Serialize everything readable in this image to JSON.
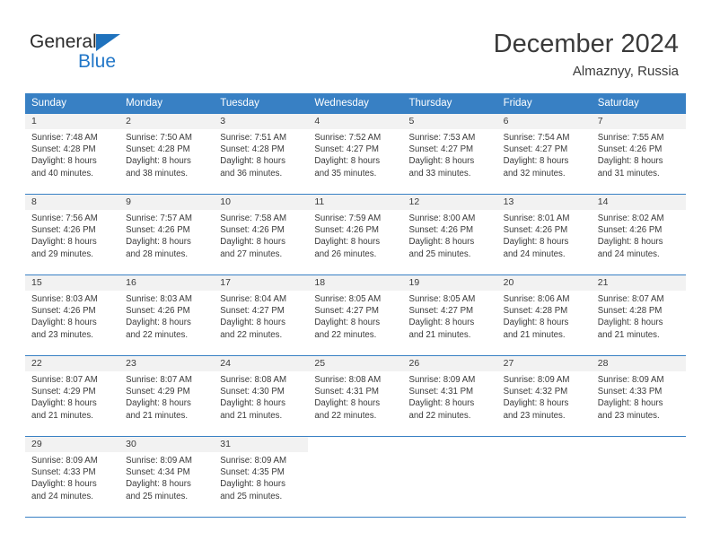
{
  "logo": {
    "word_one": "General",
    "word_two": "Blue",
    "triangle_color": "#1f72bd",
    "blue_color": "#2277c8"
  },
  "header": {
    "title": "December 2024",
    "location": "Almaznyy, Russia"
  },
  "theme": {
    "header_blue": "#3880c4",
    "daynum_band": "#f2f2f2",
    "text": "#3a3a3a"
  },
  "weekdays": [
    "Sunday",
    "Monday",
    "Tuesday",
    "Wednesday",
    "Thursday",
    "Friday",
    "Saturday"
  ],
  "weeks": [
    [
      {
        "day": "1",
        "sunrise": "Sunrise: 7:48 AM",
        "sunset": "Sunset: 4:28 PM",
        "daylight_1": "Daylight: 8 hours",
        "daylight_2": "and 40 minutes."
      },
      {
        "day": "2",
        "sunrise": "Sunrise: 7:50 AM",
        "sunset": "Sunset: 4:28 PM",
        "daylight_1": "Daylight: 8 hours",
        "daylight_2": "and 38 minutes."
      },
      {
        "day": "3",
        "sunrise": "Sunrise: 7:51 AM",
        "sunset": "Sunset: 4:28 PM",
        "daylight_1": "Daylight: 8 hours",
        "daylight_2": "and 36 minutes."
      },
      {
        "day": "4",
        "sunrise": "Sunrise: 7:52 AM",
        "sunset": "Sunset: 4:27 PM",
        "daylight_1": "Daylight: 8 hours",
        "daylight_2": "and 35 minutes."
      },
      {
        "day": "5",
        "sunrise": "Sunrise: 7:53 AM",
        "sunset": "Sunset: 4:27 PM",
        "daylight_1": "Daylight: 8 hours",
        "daylight_2": "and 33 minutes."
      },
      {
        "day": "6",
        "sunrise": "Sunrise: 7:54 AM",
        "sunset": "Sunset: 4:27 PM",
        "daylight_1": "Daylight: 8 hours",
        "daylight_2": "and 32 minutes."
      },
      {
        "day": "7",
        "sunrise": "Sunrise: 7:55 AM",
        "sunset": "Sunset: 4:26 PM",
        "daylight_1": "Daylight: 8 hours",
        "daylight_2": "and 31 minutes."
      }
    ],
    [
      {
        "day": "8",
        "sunrise": "Sunrise: 7:56 AM",
        "sunset": "Sunset: 4:26 PM",
        "daylight_1": "Daylight: 8 hours",
        "daylight_2": "and 29 minutes."
      },
      {
        "day": "9",
        "sunrise": "Sunrise: 7:57 AM",
        "sunset": "Sunset: 4:26 PM",
        "daylight_1": "Daylight: 8 hours",
        "daylight_2": "and 28 minutes."
      },
      {
        "day": "10",
        "sunrise": "Sunrise: 7:58 AM",
        "sunset": "Sunset: 4:26 PM",
        "daylight_1": "Daylight: 8 hours",
        "daylight_2": "and 27 minutes."
      },
      {
        "day": "11",
        "sunrise": "Sunrise: 7:59 AM",
        "sunset": "Sunset: 4:26 PM",
        "daylight_1": "Daylight: 8 hours",
        "daylight_2": "and 26 minutes."
      },
      {
        "day": "12",
        "sunrise": "Sunrise: 8:00 AM",
        "sunset": "Sunset: 4:26 PM",
        "daylight_1": "Daylight: 8 hours",
        "daylight_2": "and 25 minutes."
      },
      {
        "day": "13",
        "sunrise": "Sunrise: 8:01 AM",
        "sunset": "Sunset: 4:26 PM",
        "daylight_1": "Daylight: 8 hours",
        "daylight_2": "and 24 minutes."
      },
      {
        "day": "14",
        "sunrise": "Sunrise: 8:02 AM",
        "sunset": "Sunset: 4:26 PM",
        "daylight_1": "Daylight: 8 hours",
        "daylight_2": "and 24 minutes."
      }
    ],
    [
      {
        "day": "15",
        "sunrise": "Sunrise: 8:03 AM",
        "sunset": "Sunset: 4:26 PM",
        "daylight_1": "Daylight: 8 hours",
        "daylight_2": "and 23 minutes."
      },
      {
        "day": "16",
        "sunrise": "Sunrise: 8:03 AM",
        "sunset": "Sunset: 4:26 PM",
        "daylight_1": "Daylight: 8 hours",
        "daylight_2": "and 22 minutes."
      },
      {
        "day": "17",
        "sunrise": "Sunrise: 8:04 AM",
        "sunset": "Sunset: 4:27 PM",
        "daylight_1": "Daylight: 8 hours",
        "daylight_2": "and 22 minutes."
      },
      {
        "day": "18",
        "sunrise": "Sunrise: 8:05 AM",
        "sunset": "Sunset: 4:27 PM",
        "daylight_1": "Daylight: 8 hours",
        "daylight_2": "and 22 minutes."
      },
      {
        "day": "19",
        "sunrise": "Sunrise: 8:05 AM",
        "sunset": "Sunset: 4:27 PM",
        "daylight_1": "Daylight: 8 hours",
        "daylight_2": "and 21 minutes."
      },
      {
        "day": "20",
        "sunrise": "Sunrise: 8:06 AM",
        "sunset": "Sunset: 4:28 PM",
        "daylight_1": "Daylight: 8 hours",
        "daylight_2": "and 21 minutes."
      },
      {
        "day": "21",
        "sunrise": "Sunrise: 8:07 AM",
        "sunset": "Sunset: 4:28 PM",
        "daylight_1": "Daylight: 8 hours",
        "daylight_2": "and 21 minutes."
      }
    ],
    [
      {
        "day": "22",
        "sunrise": "Sunrise: 8:07 AM",
        "sunset": "Sunset: 4:29 PM",
        "daylight_1": "Daylight: 8 hours",
        "daylight_2": "and 21 minutes."
      },
      {
        "day": "23",
        "sunrise": "Sunrise: 8:07 AM",
        "sunset": "Sunset: 4:29 PM",
        "daylight_1": "Daylight: 8 hours",
        "daylight_2": "and 21 minutes."
      },
      {
        "day": "24",
        "sunrise": "Sunrise: 8:08 AM",
        "sunset": "Sunset: 4:30 PM",
        "daylight_1": "Daylight: 8 hours",
        "daylight_2": "and 21 minutes."
      },
      {
        "day": "25",
        "sunrise": "Sunrise: 8:08 AM",
        "sunset": "Sunset: 4:31 PM",
        "daylight_1": "Daylight: 8 hours",
        "daylight_2": "and 22 minutes."
      },
      {
        "day": "26",
        "sunrise": "Sunrise: 8:09 AM",
        "sunset": "Sunset: 4:31 PM",
        "daylight_1": "Daylight: 8 hours",
        "daylight_2": "and 22 minutes."
      },
      {
        "day": "27",
        "sunrise": "Sunrise: 8:09 AM",
        "sunset": "Sunset: 4:32 PM",
        "daylight_1": "Daylight: 8 hours",
        "daylight_2": "and 23 minutes."
      },
      {
        "day": "28",
        "sunrise": "Sunrise: 8:09 AM",
        "sunset": "Sunset: 4:33 PM",
        "daylight_1": "Daylight: 8 hours",
        "daylight_2": "and 23 minutes."
      }
    ],
    [
      {
        "day": "29",
        "sunrise": "Sunrise: 8:09 AM",
        "sunset": "Sunset: 4:33 PM",
        "daylight_1": "Daylight: 8 hours",
        "daylight_2": "and 24 minutes."
      },
      {
        "day": "30",
        "sunrise": "Sunrise: 8:09 AM",
        "sunset": "Sunset: 4:34 PM",
        "daylight_1": "Daylight: 8 hours",
        "daylight_2": "and 25 minutes."
      },
      {
        "day": "31",
        "sunrise": "Sunrise: 8:09 AM",
        "sunset": "Sunset: 4:35 PM",
        "daylight_1": "Daylight: 8 hours",
        "daylight_2": "and 25 minutes."
      },
      {
        "day": "",
        "sunrise": "",
        "sunset": "",
        "daylight_1": "",
        "daylight_2": ""
      },
      {
        "day": "",
        "sunrise": "",
        "sunset": "",
        "daylight_1": "",
        "daylight_2": ""
      },
      {
        "day": "",
        "sunrise": "",
        "sunset": "",
        "daylight_1": "",
        "daylight_2": ""
      },
      {
        "day": "",
        "sunrise": "",
        "sunset": "",
        "daylight_1": "",
        "daylight_2": ""
      }
    ]
  ]
}
